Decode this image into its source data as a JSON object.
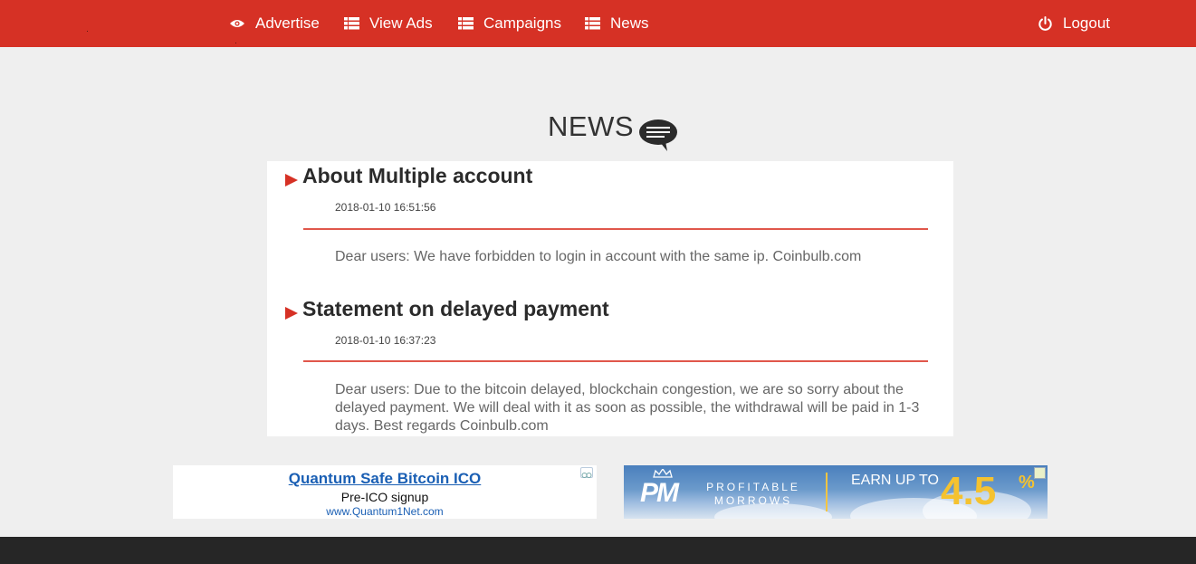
{
  "nav": {
    "items": [
      {
        "label": "Advertise",
        "icon": "eye-icon"
      },
      {
        "label": "View Ads",
        "icon": "list-icon"
      },
      {
        "label": "Campaigns",
        "icon": "list-icon"
      },
      {
        "label": "News",
        "icon": "list-icon"
      }
    ],
    "logout": {
      "label": "Logout",
      "icon": "power-icon"
    }
  },
  "page": {
    "title": "NEWS",
    "title_icon": "speech-bubble-icon"
  },
  "news": [
    {
      "title": "About Multiple account",
      "date": "2018-01-10 16:51:56",
      "body": "Dear users: We have forbidden to login in account with the same ip. Coinbulb.com"
    },
    {
      "title": "Statement on delayed payment",
      "date": "2018-01-10 16:37:23",
      "body": "Dear users: Due to the bitcoin delayed, blockchain congestion, we are so sorry about the delayed payment. We will deal with it as soon as possible, the withdrawal will be paid in 1-3 days. Best regards Coinbulb.com"
    }
  ],
  "ads": {
    "left": {
      "title": "Quantum Safe Bitcoin ICO",
      "subtitle": "Pre-ICO signup",
      "url": "www.Quantum1Net.com"
    },
    "right": {
      "logo": "PM",
      "brand": "PROFITABLE MORROWS",
      "tagline": "EARN UP TO",
      "rate": "4.5",
      "percent": "%"
    }
  },
  "colors": {
    "brand_red": "#d63125",
    "footer": "#262626",
    "background": "#efefef"
  }
}
